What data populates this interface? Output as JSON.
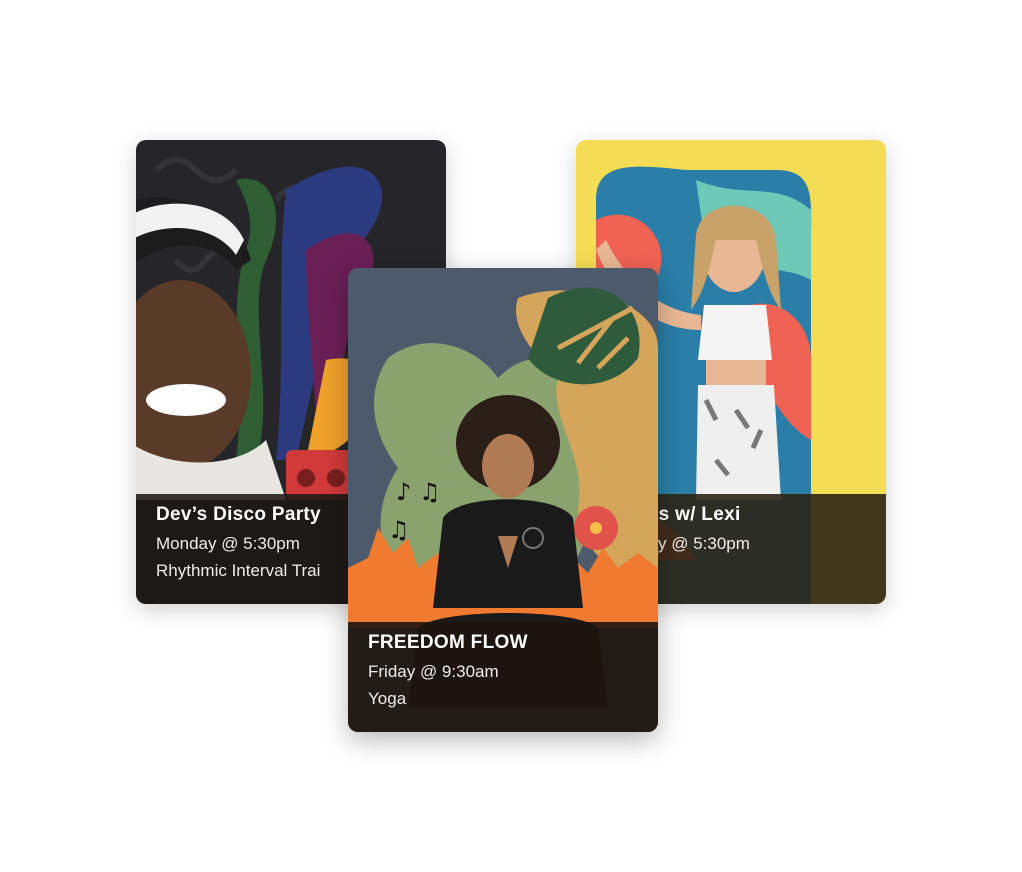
{
  "cards": [
    {
      "id": "left",
      "title": "Dev’s Disco Party",
      "schedule": "Monday @ 5:30pm",
      "category": "Rhythmic Interval Trai",
      "colors": {
        "background": "#26262a",
        "accent1": "#2f5e34",
        "accent2": "#2c3a80",
        "accent3": "#6a1f55",
        "accent4": "#f0a12a"
      }
    },
    {
      "id": "right",
      "title": "ts w/ Lexi",
      "schedule": "y @ 5:30pm",
      "colors": {
        "background": "#f5dc55",
        "accent1": "#f06254",
        "accent2": "#2a7ea8",
        "accent3": "#6ec9b8"
      }
    },
    {
      "id": "center",
      "title": "FREEDOM FLOW",
      "schedule": "Friday @ 9:30am",
      "category": "Yoga",
      "colors": {
        "background": "#4c5a6c",
        "accent1": "#8aa36e",
        "accent2": "#d4a55a",
        "accent3": "#2d5b3c",
        "accent4": "#f07a30"
      }
    }
  ]
}
